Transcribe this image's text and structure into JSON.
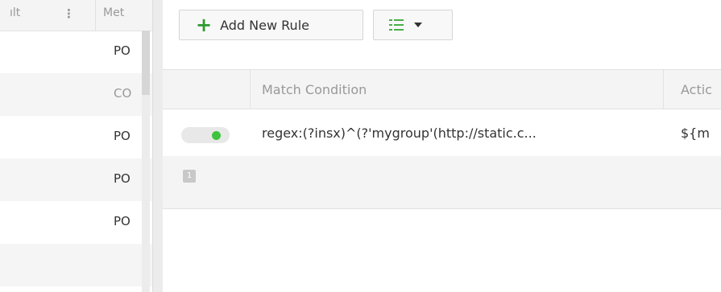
{
  "left_list": {
    "columns": {
      "result": "ılt",
      "method": "Met"
    },
    "rows": [
      {
        "method": "PO",
        "dim": false
      },
      {
        "method": "CO",
        "dim": true
      },
      {
        "method": "PO",
        "dim": false
      },
      {
        "method": "PO",
        "dim": false
      },
      {
        "method": "PO",
        "dim": false
      }
    ]
  },
  "toolbar": {
    "add_rule_label": "Add New Rule",
    "add_icon": "plus-icon",
    "view_icon": "list-icon",
    "view_caret_icon": "caret-down-icon"
  },
  "rules_table": {
    "columns": [
      "Match Condition",
      "Actic"
    ],
    "rows": [
      {
        "enabled": true,
        "match_condition": "regex:(?insx)^(?'mygroup'(http://static.c...",
        "action": "${m"
      }
    ]
  },
  "pagination": {
    "current_page": "1"
  },
  "colors": {
    "accent_green": "#2e9a2e",
    "toggle_on": "#3fc33f",
    "header_bg": "#f4f4f4"
  }
}
